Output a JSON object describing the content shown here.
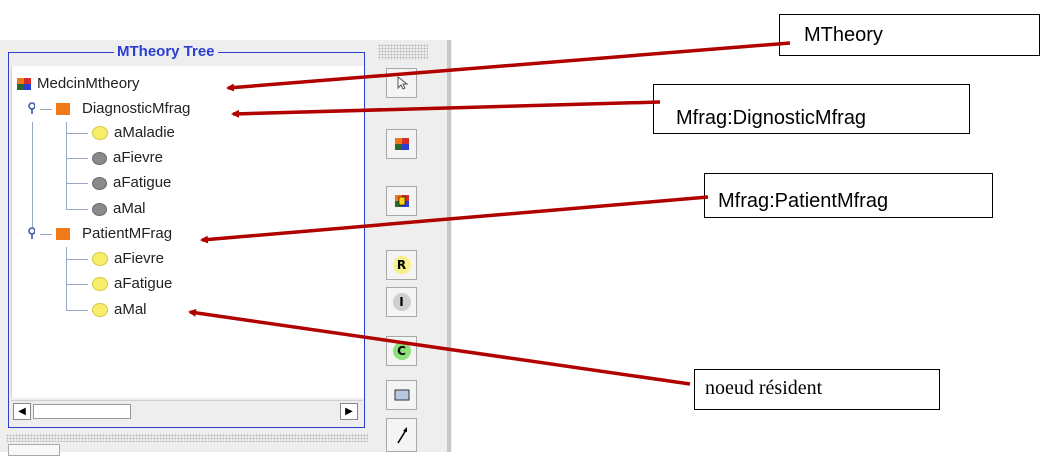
{
  "panel": {
    "title": "MTheory Tree"
  },
  "tree": {
    "root": {
      "label": "MedcinMtheory",
      "icon": "mtheory-icon"
    },
    "mfrags": [
      {
        "label": "DiagnosticMfrag",
        "icon": "mfrag-icon",
        "nodes": [
          {
            "label": "aMaladie",
            "type": "resident"
          },
          {
            "label": "aFievre",
            "type": "input"
          },
          {
            "label": "aFatigue",
            "type": "input"
          },
          {
            "label": "aMal",
            "type": "input"
          }
        ]
      },
      {
        "label": "PatientMFrag",
        "icon": "mfrag-icon",
        "nodes": [
          {
            "label": "aFievre",
            "type": "resident"
          },
          {
            "label": "aFatigue",
            "type": "resident"
          },
          {
            "label": "aMal",
            "type": "resident"
          }
        ]
      }
    ]
  },
  "toolbar": {
    "buttons": [
      {
        "name": "select-pointer-button",
        "icon": "pointer-icon"
      },
      {
        "name": "new-mtheory-button",
        "icon": "mtheory-icon"
      },
      {
        "name": "new-mfrag-button",
        "icon": "mfrag-add-icon"
      },
      {
        "name": "resident-node-button",
        "glyph": "R"
      },
      {
        "name": "input-node-button",
        "glyph": "I"
      },
      {
        "name": "context-node-button",
        "glyph": "C"
      },
      {
        "name": "ordinary-variable-button",
        "icon": "rectangle-icon"
      },
      {
        "name": "edge-button",
        "icon": "arrow-icon"
      }
    ]
  },
  "callouts": [
    {
      "name": "callout-mtheory",
      "text": "MTheory"
    },
    {
      "name": "callout-diagnostic",
      "text": "Mfrag:DignosticMfrag"
    },
    {
      "name": "callout-patient",
      "text": "Mfrag:PatientMfrag"
    },
    {
      "name": "callout-resident",
      "text": "noeud résident"
    }
  ],
  "colors": {
    "panel_border": "#2a3fd1",
    "mfrag": "#f07a1a",
    "resident_node": "#f8ee6a",
    "input_node": "#8a8a8a",
    "arrow": "#b00000",
    "resident_button": "#f5f08a",
    "input_button": "#cfcfcf",
    "context_button": "#8ee07a"
  }
}
